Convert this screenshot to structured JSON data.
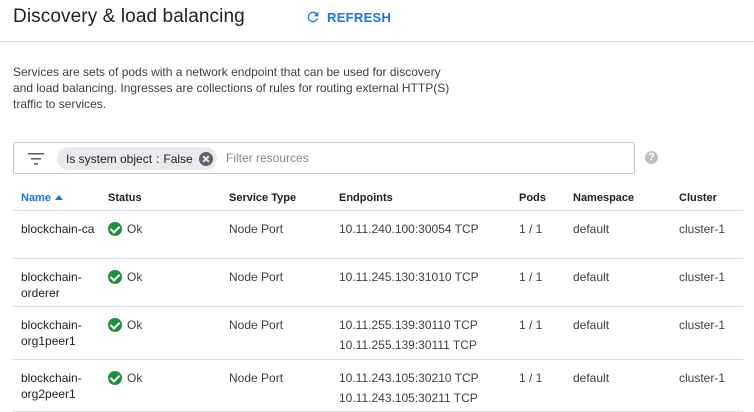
{
  "header": {
    "title": "Discovery & load balancing",
    "refresh_label": "REFRESH"
  },
  "description": "Services are sets of pods with a network endpoint that can be used for discovery and load balancing. Ingresses are collections of rules for routing external HTTP(S) traffic to services.",
  "filter": {
    "chip_key": "Is system object",
    "chip_sep": ":",
    "chip_value": "False",
    "placeholder": "Filter resources",
    "help_glyph": "?"
  },
  "table": {
    "columns": [
      "Name",
      "Status",
      "Service Type",
      "Endpoints",
      "Pods",
      "Namespace",
      "Cluster"
    ],
    "rows": [
      {
        "name": "blockchain-ca",
        "status": "Ok",
        "type": "Node Port",
        "endpoints": [
          "10.11.240.100:30054 TCP"
        ],
        "pods": "1 / 1",
        "namespace": "default",
        "cluster": "cluster-1"
      },
      {
        "name": "blockchain-orderer",
        "status": "Ok",
        "type": "Node Port",
        "endpoints": [
          "10.11.245.130:31010 TCP"
        ],
        "pods": "1 / 1",
        "namespace": "default",
        "cluster": "cluster-1"
      },
      {
        "name": "blockchain-org1peer1",
        "status": "Ok",
        "type": "Node Port",
        "endpoints": [
          "10.11.255.139:30110 TCP",
          "10.11.255.139:30111 TCP"
        ],
        "pods": "1 / 1",
        "namespace": "default",
        "cluster": "cluster-1"
      },
      {
        "name": "blockchain-org2peer1",
        "status": "Ok",
        "type": "Node Port",
        "endpoints": [
          "10.11.243.105:30210 TCP",
          "10.11.243.105:30211 TCP"
        ],
        "pods": "1 / 1",
        "namespace": "default",
        "cluster": "cluster-1"
      }
    ]
  },
  "colors": {
    "accent": "#1a73e8",
    "ok": "#1e8e3e"
  }
}
